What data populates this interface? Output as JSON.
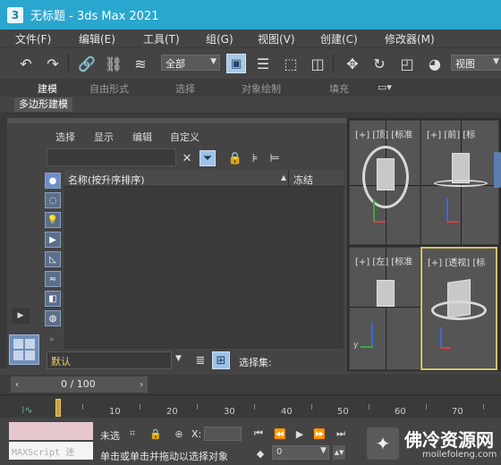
{
  "window": {
    "title": "无标题 - 3ds Max 2021",
    "app_icon": "3"
  },
  "menu": [
    "文件(F)",
    "编辑(E)",
    "工具(T)",
    "组(G)",
    "视图(V)",
    "创建(C)",
    "修改器(M)"
  ],
  "toolbar": {
    "selection_filter": "全部",
    "reference_coord": "视图"
  },
  "ribbon": {
    "tabs": [
      "建模",
      "自由形式",
      "选择",
      "对象绘制",
      "填充"
    ],
    "active_tab": "建模",
    "sub_panel": "多边形建模"
  },
  "scene_explorer": {
    "menu": [
      "选择",
      "显示",
      "编辑",
      "自定义"
    ],
    "columns": {
      "name": "名称(按升序排序)",
      "freeze": "冻结"
    },
    "layer": "默认",
    "selection_set_label": "选择集:"
  },
  "viewports": {
    "top": "[+] [顶] [标准",
    "front": "[+] [前] [标",
    "left": "[+] [左] [标准",
    "perspective": "[+] [透视] [标"
  },
  "timeline": {
    "frame_display": "0 / 100",
    "ruler_ticks": [
      "10",
      "20",
      "30",
      "40",
      "50",
      "60",
      "70"
    ]
  },
  "status": {
    "selection": "未选",
    "prompt": "单击或单击并拖动以选择对象",
    "coord_x_label": "X:",
    "maxscript": "MAXScript 迷",
    "current_frame": "0"
  },
  "watermark": {
    "title": "佛冷资源网",
    "url": "moilefoleng.com"
  },
  "colors": {
    "title_bar": "#2aa7cf",
    "active_tool": "#aac7e6",
    "viewport_active_border": "#d8c06a",
    "layer_text": "#f0d060"
  }
}
